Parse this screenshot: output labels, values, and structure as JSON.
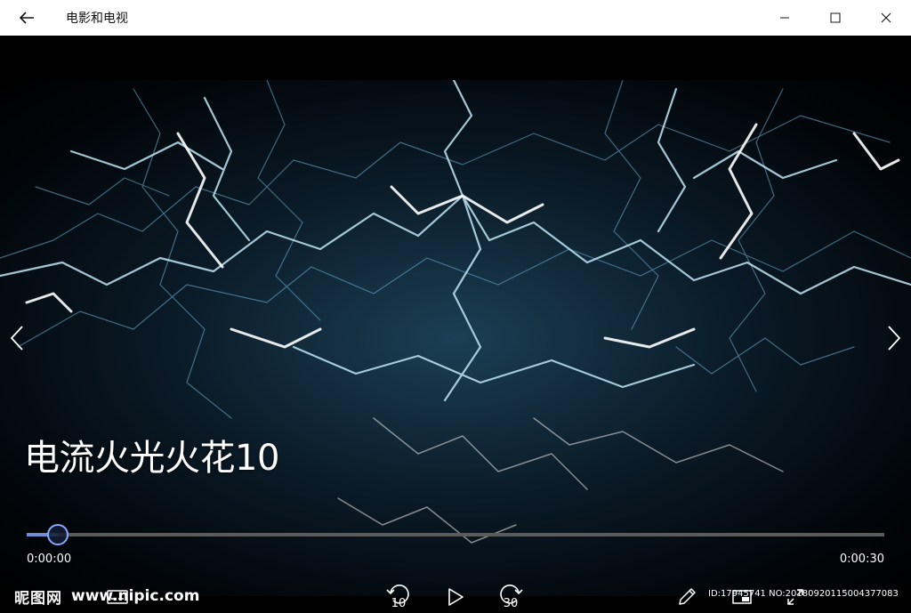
{
  "titlebar": {
    "title": "电影和电视",
    "back_icon": "back-arrow-icon",
    "minimize_icon": "minimize-icon",
    "maximize_icon": "maximize-icon",
    "close_icon": "close-icon"
  },
  "video": {
    "title": "电流火光火花10",
    "progress_fraction": 0.036,
    "current_time": "0:00:00",
    "total_time": "0:00:30"
  },
  "controls": {
    "skip_back_label": "10",
    "skip_forward_label": "30",
    "play_icon": "play-icon",
    "edit_icon": "pencil-icon",
    "captions_icon": "captions-icon",
    "screen_icon": "mini-view-icon",
    "fullscreen_icon": "fullscreen-icon"
  },
  "watermark": {
    "logo": "昵图网",
    "site": "www.nipic.com",
    "id": "ID:17945741 NO:20180920115004377083"
  },
  "colors": {
    "titlebar_bg": "#ffffff",
    "stage_bg": "#000000",
    "accent": "#6f8dd4"
  }
}
